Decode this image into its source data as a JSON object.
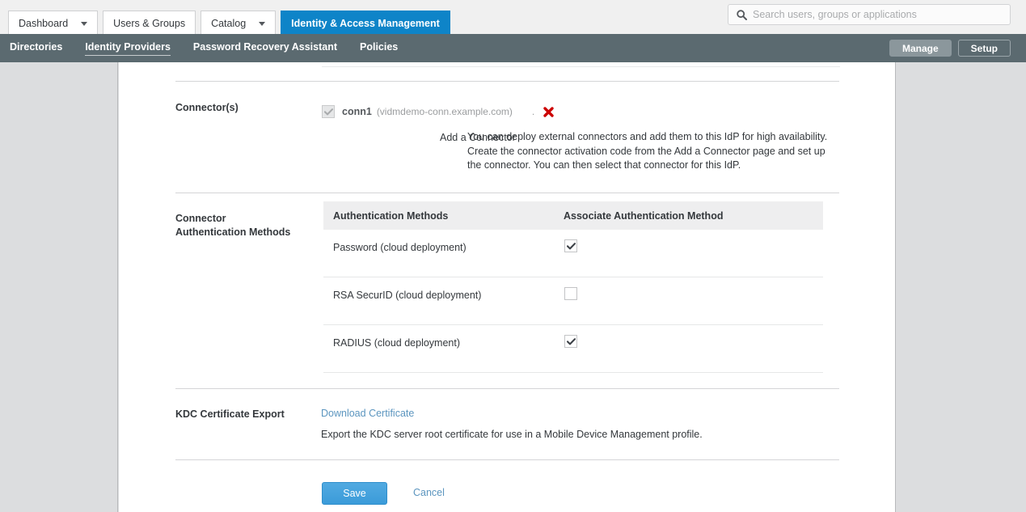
{
  "topbar": {
    "tabs": [
      {
        "label": "Dashboard",
        "has_caret": true,
        "active": false
      },
      {
        "label": "Users & Groups",
        "has_caret": false,
        "active": false
      },
      {
        "label": "Catalog",
        "has_caret": true,
        "active": false
      },
      {
        "label": "Identity & Access Management",
        "has_caret": false,
        "active": true
      }
    ],
    "search": {
      "placeholder": "Search users, groups or applications",
      "value": "",
      "icon": "search-icon"
    }
  },
  "subnav": {
    "items": [
      {
        "label": "Directories",
        "active": false
      },
      {
        "label": "Identity Providers",
        "active": true
      },
      {
        "label": "Password Recovery Assistant",
        "active": false
      },
      {
        "label": "Policies",
        "active": false
      }
    ],
    "actions": [
      {
        "label": "Manage",
        "filled": true
      },
      {
        "label": "Setup",
        "filled": false
      }
    ]
  },
  "form": {
    "connectors": {
      "label": "Connector(s)",
      "item": {
        "checked": true,
        "disabled": true,
        "name": "conn1",
        "host": "(vidmdemo-conn.example.com)",
        "separator": ".",
        "delete_icon": "delete-x-icon"
      },
      "add_label": "Add a Connector",
      "add_description": "You can deploy external connectors and add them to this IdP for high availability. Create the connector activation code from the Add a Connector page and set up the connector. You can then select that connector for this IdP."
    },
    "auth_methods": {
      "label_line1": "Connector",
      "label_line2": "Authentication Methods",
      "columns": [
        "Authentication Methods",
        "Associate Authentication Method"
      ],
      "rows": [
        {
          "name": "Password (cloud deployment)",
          "associated": true
        },
        {
          "name": "RSA SecurID (cloud deployment)",
          "associated": false
        },
        {
          "name": "RADIUS (cloud deployment)",
          "associated": true
        }
      ]
    },
    "kdc": {
      "label": "KDC Certificate Export",
      "link": "Download Certificate",
      "description": "Export the KDC server root certificate for use in a Mobile Device Management profile."
    },
    "footer": {
      "save": "Save",
      "cancel": "Cancel"
    }
  },
  "colors": {
    "active_tab_blue": "#0e84c8",
    "subnav_slate": "#5b6a70",
    "link_blue": "#5b95bf",
    "save_blue": "#3b9bd9",
    "delete_red": "#cc0000",
    "page_grey": "#dcdddf"
  }
}
